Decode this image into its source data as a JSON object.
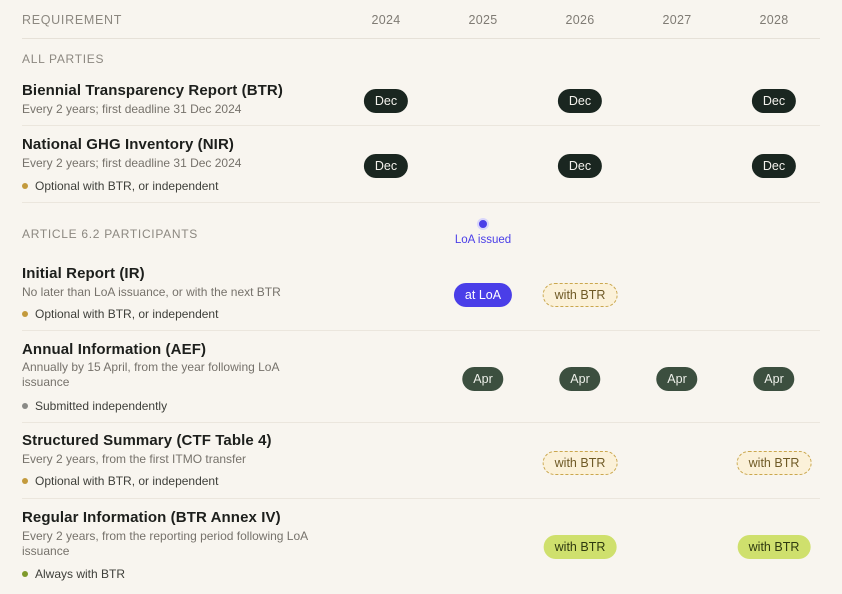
{
  "header": {
    "requirement": "REQUIREMENT",
    "years": [
      "2024",
      "2025",
      "2026",
      "2027",
      "2028"
    ]
  },
  "sections": {
    "all_parties": "ALL PARTIES",
    "article": "ARTICLE 6.2 PARTICIPANTS"
  },
  "loa": {
    "label": "LoA issued"
  },
  "rows": [
    {
      "title": "Biennial Transparency Report (BTR)",
      "sub": "Every 2 years; first deadline 31 Dec 2024",
      "pills": [
        "Dec",
        "Dec",
        "Dec"
      ]
    },
    {
      "title": "National GHG Inventory (NIR)",
      "sub": "Every 2 years; first deadline 31 Dec 2024",
      "note": "Optional with BTR, or independent",
      "pills": [
        "Dec",
        "Dec",
        "Dec"
      ]
    },
    {
      "title": "Initial Report (IR)",
      "sub": "No later than LoA issuance, or with the next BTR",
      "note": "Optional with BTR, or independent",
      "pills": [
        "at LoA",
        "with BTR"
      ]
    },
    {
      "title": "Annual Information (AEF)",
      "sub": "Annually by 15 April, from the year following LoA issuance",
      "note": "Submitted independently",
      "pills": [
        "Apr",
        "Apr",
        "Apr",
        "Apr"
      ]
    },
    {
      "title": "Structured Summary (CTF Table 4)",
      "sub": "Every 2 years, from the first ITMO transfer",
      "note": "Optional with BTR, or independent",
      "pills": [
        "with BTR",
        "with BTR"
      ]
    },
    {
      "title": "Regular Information (BTR Annex IV)",
      "sub": "Every 2 years, from the reporting period following LoA issuance",
      "note": "Always with BTR",
      "pills": [
        "with BTR",
        "with BTR"
      ]
    }
  ],
  "colors": {
    "optional_dot": "#c39a3c",
    "independent_dot": "#8a8a86",
    "always_dot": "#7f9a2b",
    "accent_blue": "#4a3ee8"
  }
}
